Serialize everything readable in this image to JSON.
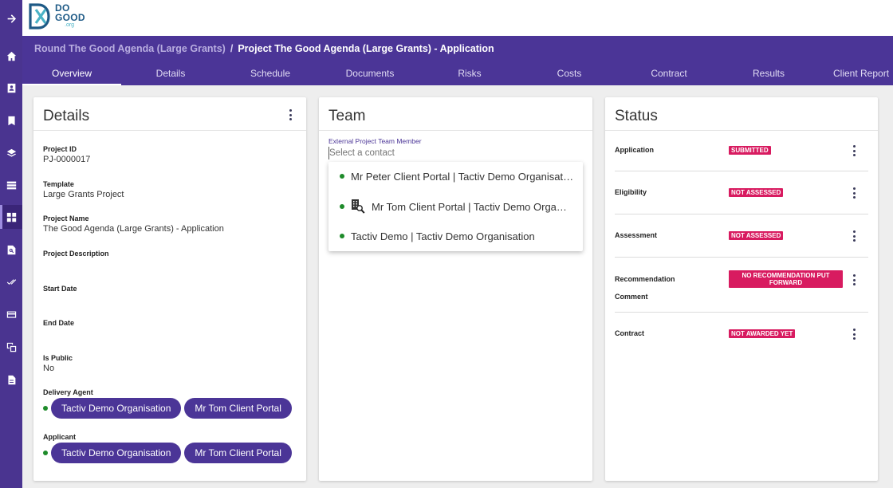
{
  "brand": {
    "line1": "DO",
    "line2": "GOOD",
    "line3": ".org",
    "colors": {
      "purple": "#4b3597",
      "rail": "#4a3490",
      "badge": "#d81b60",
      "dot": "#1e8b2a",
      "logo": "#1e5a86"
    }
  },
  "rail": {
    "icons": [
      "arrow-right-icon",
      "home-icon",
      "contacts-icon",
      "bookmark-icon",
      "layers-icon",
      "list-icon",
      "dashboard-icon",
      "search-document-icon",
      "double-check-icon",
      "card-icon",
      "copy-icon",
      "document-icon"
    ]
  },
  "breadcrumb": {
    "parent": "Round The Good Agenda (Large Grants)",
    "separator": "/",
    "current": "Project The Good Agenda (Large Grants) - Application"
  },
  "tabs": [
    "Overview",
    "Details",
    "Schedule",
    "Documents",
    "Risks",
    "Costs",
    "Contract",
    "Results",
    "Client Report"
  ],
  "details": {
    "title": "Details",
    "fields": {
      "project_id_label": "Project ID",
      "project_id": "PJ-0000017",
      "template_label": "Template",
      "template": "Large Grants Project",
      "project_name_label": "Project Name",
      "project_name": "The Good Agenda (Large Grants) - Application",
      "project_description_label": "Project Description",
      "start_date_label": "Start Date",
      "end_date_label": "End Date",
      "is_public_label": "Is Public",
      "is_public": "No",
      "delivery_agent_label": "Delivery Agent",
      "applicant_label": "Applicant"
    },
    "delivery_agent_chips": [
      "Tactiv Demo Organisation",
      "Mr Tom Client Portal"
    ],
    "applicant_chips": [
      "Tactiv Demo Organisation",
      "Mr Tom Client Portal"
    ]
  },
  "team": {
    "title": "Team",
    "field_label": "External Project Team Member",
    "placeholder": "Select a contact",
    "options": [
      "Mr Peter Client Portal | Tactiv Demo Organisation",
      "Mr Tom Client Portal | Tactiv Demo Organisation",
      "Tactiv Demo | Tactiv Demo Organisation"
    ]
  },
  "status": {
    "title": "Status",
    "rows": [
      {
        "label": "Application",
        "badge": "SUBMITTED"
      },
      {
        "label": "Eligibility",
        "badge": "NOT ASSESSED"
      },
      {
        "label": "Assessment",
        "badge": "NOT ASSESSED"
      },
      {
        "label": "Recommendation",
        "label2": "Comment",
        "badge": "NO RECOMMENDATION PUT FORWARD"
      },
      {
        "label": "Contract",
        "badge": "NOT AWARDED YET"
      }
    ]
  }
}
